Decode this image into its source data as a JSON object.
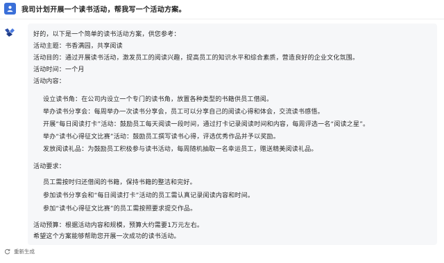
{
  "conversation": {
    "user_message": "我司计划开展一个读书活动，帮我写一个活动方案。",
    "bot_reply": {
      "intro": "好的，以下是一个简单的读书活动方案，供您参考：",
      "theme": "活动主题：书香满园，共享阅读",
      "purpose": "活动目的：通过开展读书活动，激发员工的阅读兴趣，提高员工的知识水平和综合素质，营造良好的企业文化氛围。",
      "time": "活动时间：一个月",
      "content_heading": "活动内容：",
      "content_items": [
        "设立读书角：在公司内设立一个专门的读书角，放置各种类型的书籍供员工借阅。",
        "举办读书分享会：每周举办一次读书分享会，员工可以分享自己的阅读心得和体会，交流读书感悟。",
        "开展“每日阅读打卡”活动：鼓励员工每天阅读一段时间，通过打卡记录阅读时间和内容，每周评选一名“阅读之星”。",
        "举办“读书心得征文比赛”活动：鼓励员工撰写读书心得，评选优秀作品并予以奖励。",
        "发放阅读礼品：为鼓励员工积极参与读书活动，每周随机抽取一名幸运员工，赠送精美阅读礼品。"
      ],
      "requirements_heading": "活动要求：",
      "requirement_items": [
        "员工需按时归还借阅的书籍，保持书籍的整洁和完好。",
        "参加读书分享会和“每日阅读打卡”活动的员工需认真记录阅读内容和时间。",
        "参加“读书心得征文比赛”的员工需按照要求提交作品。"
      ],
      "budget": "活动预算：根据活动内容和规模，预算大约需要1万元左右。",
      "closing": "希望这个方案能够帮助您开展一次成功的读书活动。"
    },
    "regenerate_label": "重新生成"
  }
}
